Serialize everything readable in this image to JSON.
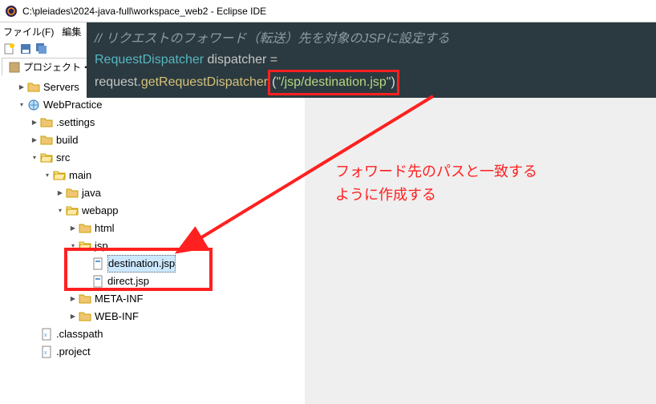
{
  "window": {
    "title": "C:\\pleiades\\2024-java-full\\workspace_web2 - Eclipse IDE"
  },
  "menu": {
    "file": "ファイル(F)",
    "edit": "編集"
  },
  "explorer": {
    "tab_label": "プロジェクト・エ",
    "tree": {
      "servers": "Servers",
      "webpractice": "WebPractice",
      "settings": ".settings",
      "build": "build",
      "src": "src",
      "main": "main",
      "java": "java",
      "webapp": "webapp",
      "html": "html",
      "jsp": "jsp",
      "destination_jsp": "destination.jsp",
      "direct_jsp": "direct.jsp",
      "meta_inf": "META-INF",
      "web_inf": "WEB-INF",
      "classpath": ".classpath",
      "project": ".project"
    }
  },
  "code": {
    "comment": "// リクエストのフォワード（転送）先を対象のJSPに設定する",
    "line2_type": "RequestDispatcher",
    "line2_var": " dispatcher =",
    "line3_indent": "    ",
    "line3_obj": "request.",
    "line3_method": "getRequestDispatcher",
    "line3_paren_open": "(",
    "line3_string": "\"/jsp/destination.jsp\"",
    "line3_paren_close": ")"
  },
  "annotation": {
    "line1": "フォワード先のパスと一致する",
    "line2": "ように作成する"
  }
}
